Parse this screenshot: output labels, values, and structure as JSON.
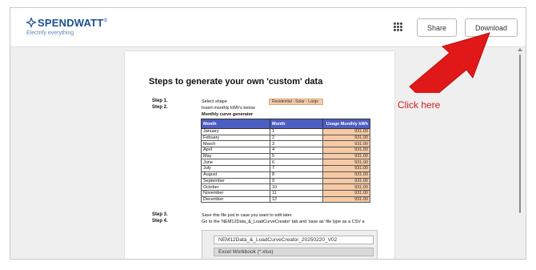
{
  "header": {
    "logo_name": "SPENDWATT",
    "logo_mark": "®",
    "logo_tagline": "Electrify everything",
    "apps_icon": "grid-dots-icon",
    "share_label": "Share",
    "download_label": "Download"
  },
  "document": {
    "title": "Steps to generate your own 'custom' data",
    "steps": [
      {
        "label": "Step 1.",
        "text": "Select shape"
      },
      {
        "label": "Step 2.",
        "text": "Insert monthly kWh's below"
      },
      {
        "label": "Step 3.",
        "text": "Save this file just in case you want to edit later"
      },
      {
        "label": "Step 4.",
        "text": "Go to the 'NEM12Data_&_LoadCurveCreator' tab and 'save as' file type as a CSV a"
      }
    ],
    "shape_value": "Residential - Solar - Large",
    "table_title": "Monthly curve generator",
    "columns": [
      "Month",
      "Month",
      "Usage Monthly kWh"
    ],
    "rows": [
      {
        "name": "January",
        "num": "1",
        "usage": "931.00"
      },
      {
        "name": "Febuary",
        "num": "2",
        "usage": "931.00"
      },
      {
        "name": "March",
        "num": "3",
        "usage": "931.00"
      },
      {
        "name": "April",
        "num": "4",
        "usage": "931.00"
      },
      {
        "name": "May",
        "num": "5",
        "usage": "931.00"
      },
      {
        "name": "June",
        "num": "6",
        "usage": "931.00"
      },
      {
        "name": "July",
        "num": "7",
        "usage": "931.00"
      },
      {
        "name": "August",
        "num": "8",
        "usage": "931.00"
      },
      {
        "name": "September",
        "num": "9",
        "usage": "931.00"
      },
      {
        "name": "October",
        "num": "10",
        "usage": "931.00"
      },
      {
        "name": "November",
        "num": "11",
        "usage": "931.00"
      },
      {
        "name": "December",
        "num": "12",
        "usage": "931.00"
      }
    ],
    "save_dialog": {
      "filename": "NEM12Data_&_LoadCurveCreator_20250220_V02",
      "filetype": "Excel Workbook (*.xlsx)"
    }
  },
  "annotation": {
    "callout": "Click here",
    "arrow_color": "#e01818"
  },
  "colors": {
    "table_header": "#4d5ec3",
    "usage_cell": "#f6caa4",
    "brand": "#1d4f91"
  }
}
